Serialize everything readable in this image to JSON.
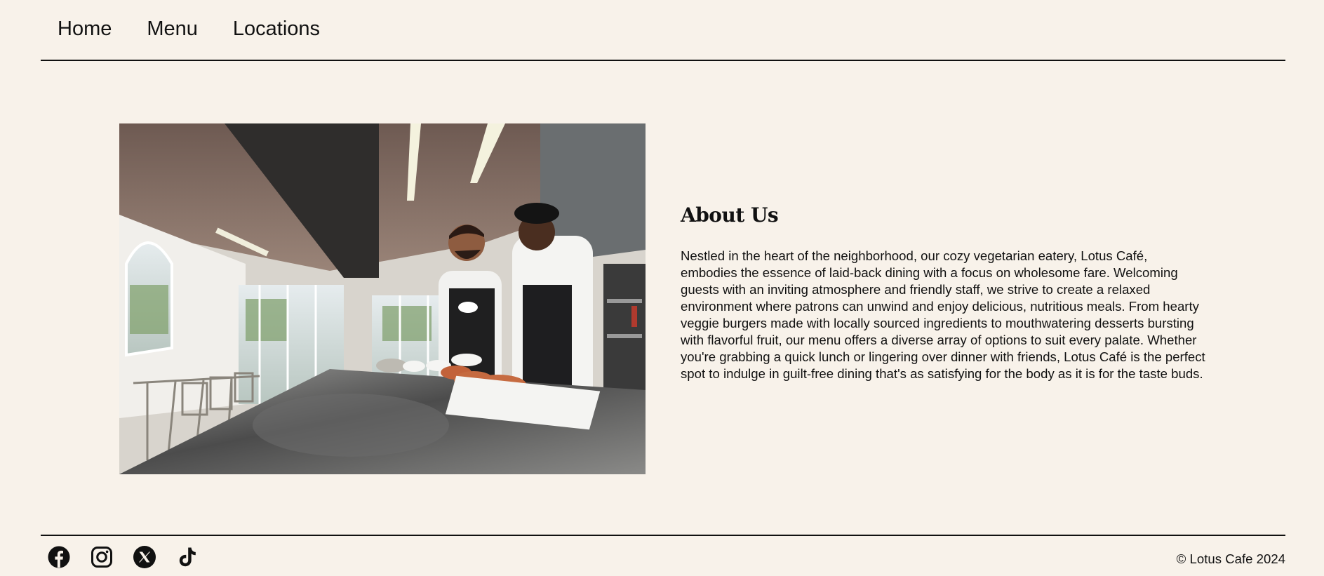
{
  "nav": {
    "items": [
      {
        "label": "Home"
      },
      {
        "label": "Menu"
      },
      {
        "label": "Locations"
      }
    ]
  },
  "about": {
    "title": "About Us",
    "body": "Nestled in the heart of the neighborhood, our cozy vegetarian eatery, Lotus Café, embodies the essence of laid-back dining with a focus on wholesome fare. Welcoming guests with an inviting atmosphere and friendly staff, we strive to create a relaxed environment where patrons can unwind and enjoy delicious, nutritious meals. From hearty veggie burgers made with locally sourced ingredients to mouthwatering desserts bursting with flavorful fruit, our menu offers a diverse array of options to suit every palate. Whether you're grabbing a quick lunch or lingering over dinner with friends, Lotus Café is the perfect spot to indulge in guilt-free dining that's as satisfying for the body as it is for the taste buds."
  },
  "footer": {
    "copyright": "© Lotus Cafe 2024",
    "social": [
      "facebook-icon",
      "instagram-icon",
      "x-icon",
      "tiktok-icon"
    ]
  },
  "colors": {
    "background": "#f8f2ea",
    "text": "#111111"
  }
}
